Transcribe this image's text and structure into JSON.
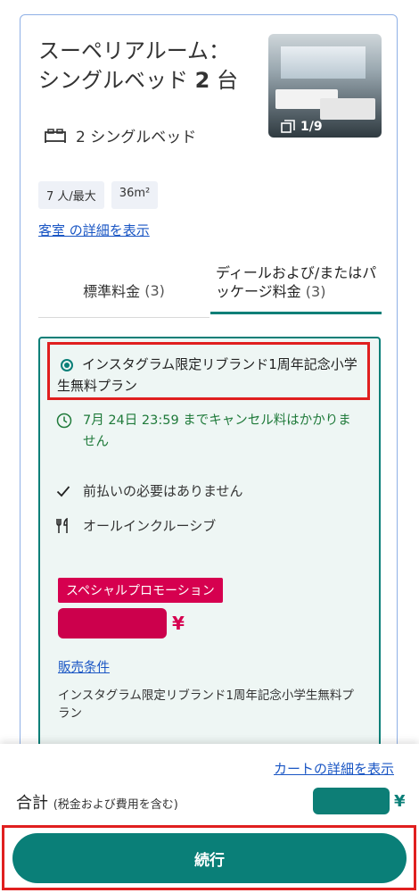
{
  "room": {
    "title_line1": "スーペリアルーム：",
    "title_line2": "シングルベッド",
    "title_number": "2",
    "title_suffix": "台",
    "image_counter": "1/9",
    "beds": "2 シングルベッド",
    "chips": [
      "7 人/最大",
      "36m²"
    ],
    "details_link": "客室 の詳細を表示"
  },
  "tabs": [
    {
      "label": "標準料金",
      "count": "(3)"
    },
    {
      "label": "ディールおよび/またはパッケージ料金",
      "count": "(3)"
    }
  ],
  "plan": {
    "name": "インスタグラム限定リブランド1周年記念小学生無料プラン",
    "cancellation": "7月 24日 23:59 までキャンセル料はかかりません",
    "features": [
      "前払いの必要はありません",
      "オールインクルーシブ"
    ],
    "promo_badge": "スペシャルプロモーション",
    "currency": "¥",
    "sales_conditions_link": "販売条件",
    "sales_conditions_text": "インスタグラム限定リブランド1周年記念小学生無料プラン"
  },
  "footer": {
    "cart_link": "カートの詳細を表示",
    "total_label": "合計",
    "total_sub": "(税金および費用を含む)",
    "currency": "¥",
    "continue_label": "続行"
  },
  "colors": {
    "accent": "#0a7f78",
    "promo": "#d6004f",
    "link": "#1a56c4",
    "highlight": "#e01f1f"
  }
}
